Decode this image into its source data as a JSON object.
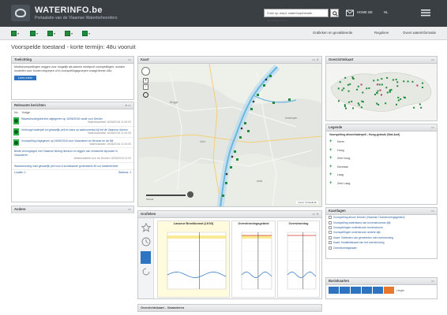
{
  "app": {
    "brand": "WATERINFO.be",
    "brand_sub": "Portaalsite van de Vlaamse Waterbeheerders",
    "search_placeholder": "Zoek op dorpt, waterloop/lokatie, stroomgebied...",
    "header_link_1": "HOME BE",
    "header_link_2": "NL"
  },
  "toolbar": {
    "right_1": "Grafieken en gevalideerde",
    "right_2": "Reguliere",
    "right_3": "Overs waterinformatie"
  },
  "page_title": "Voorspelde toestand - korte termijn: 48u vooruit",
  "panels": {
    "overview": {
      "title": "Toelichting",
      "text": "Modelvoorspellingen zeggen voor mogelijk als actuele meetpunt voorspellingen, worden modellen voor fonden begrepen of in voorspellingsgroepen vraagt binnen 48u",
      "button": "Lees meer"
    },
    "realtime": {
      "title": "Relevante berichten",
      "tab_1": "Nu",
      "tab_2": "Vorige",
      "items": [
        {
          "text": "Waarschuwingsbericht uitgegeven op 16/06/2016 vanaf voor Dender",
          "meta": "Waterkwantiteit 16/06/2016 11:00:00"
        },
        {
          "text": "Verhoogd waterpeil tot gevaarlijk peil en kans op wateroverlast bij het de Vlaamse rivieren",
          "meta": "Waterkwantiteit 16/06/2016 11:00:00"
        },
        {
          "text": "Voorspelling uitgegeven op 15/06/2016 voor Vlaanderen en Brussel en de Mit",
          "meta": "Waterstanden 15/06/2016 11:00:00"
        },
        {
          "text": "Beste verzorgingen met Vlaamse leiding hierdoor en leggen van verwachte bijzonder in Vlaanderen",
          "meta": "Waterkwaliteit voor de Dender 15/06/2016 11:00"
        },
        {
          "text": "Waarschuwing naar gevaarlijk peil voor 6 luchtwaarde grotendeels 46 uur kwaterbeheer",
          "meta": ""
        }
      ],
      "pager_left": "Locatie: 1",
      "pager_right": "Stations: 1"
    },
    "other": {
      "title": "Andere"
    },
    "map": {
      "title": "Kaart",
      "zoom_in": "+",
      "zoom_out": "-",
      "scale_text": "Schaal",
      "attribution": "Kaart: Schaalbalk"
    },
    "overview_map": {
      "title": "Overzichtskaart"
    },
    "legend": {
      "title": "Legende",
      "subtitle": "Voorspelling afvoer/waterpeil - Hoog-gebruik (Stat-kort)",
      "items": [
        "Norm",
        "Hoog",
        "Zeer hoog",
        "Normaal",
        "Laag",
        "Zeer Laag"
      ]
    },
    "layers": {
      "title": "Kaartlagen",
      "items": [
        "Voorspelling afvoer Dender (Vlaamse Overstromingsgebied)",
        "Voorspelling waterstand van bovenstroomse dijk",
        "Voorspellingen onderstroom bovenstroom",
        "Voorspellingen onderstroom andere dijk",
        "Kaart: Gebieden van gemeenten met overstroming",
        "Kaart: Kwaliteitskaart van het overstroming",
        "Overstromingskaart"
      ]
    },
    "palette": {
      "title": "Basiskaarten",
      "label": "Leegte",
      "swatch_colors": [
        "#2f74c0",
        "#2f74c0",
        "#2f74c0",
        "#2f74c0",
        "#2f74c0",
        "#e8792c"
      ]
    },
    "graphs": {
      "title": "Grafieken",
      "chart_1_title": "Lasseur Broekkomst (LK03)",
      "chart_2_title": "Overstromingsgebied",
      "chart_3_title": "Overstroming"
    },
    "bottom": {
      "title": "Overzichtskaart - Vlaanderen"
    }
  },
  "colors": {
    "header": "#3a3f44",
    "green": "#1e8a3b",
    "blue": "#2f74c0",
    "orange": "#e8792c"
  }
}
